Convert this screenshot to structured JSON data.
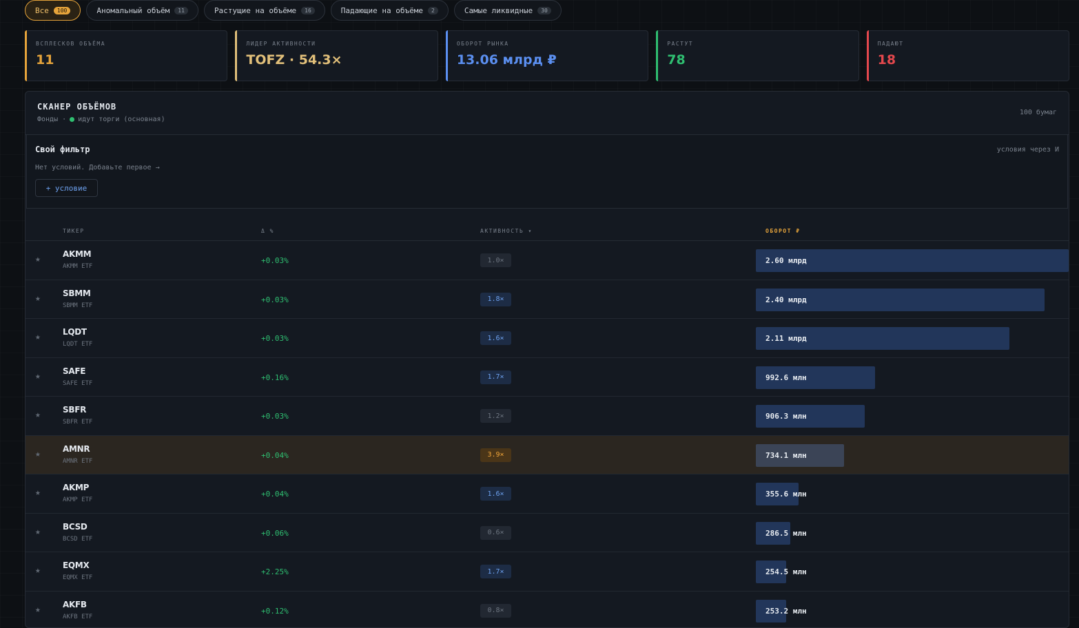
{
  "tabs": [
    {
      "label": "Все",
      "count": "100"
    },
    {
      "label": "Аномальный объём",
      "count": "11"
    },
    {
      "label": "Растущие на объёме",
      "count": "16"
    },
    {
      "label": "Падающие на объёме",
      "count": "2"
    },
    {
      "label": "Самые ликвидные",
      "count": "30"
    }
  ],
  "stats": [
    {
      "label": "всплесков объёма",
      "value": "11",
      "color": "#e6a43b"
    },
    {
      "label": "лидер активности",
      "value": "TOFZ · 54.3×",
      "color": "#e2c07a"
    },
    {
      "label": "оборот рынка",
      "value": "13.06 млрд ₽",
      "color": "#5b8ff0"
    },
    {
      "label": "растут",
      "value": "78",
      "color": "#2fbf71"
    },
    {
      "label": "падают",
      "value": "18",
      "color": "#e5484d"
    }
  ],
  "panel": {
    "title": "СКАНЕР ОБЪЁМОВ",
    "sub_prefix": "Фонды ·",
    "sub_status": "идут торги (основная)",
    "count": "100 бумаг"
  },
  "filter": {
    "title": "Свой фильтр",
    "hint": "условия через И",
    "empty": "Нет условий. Добавьте первое →",
    "add_label": "+ условие"
  },
  "columns": {
    "ticker": "ТИКЕР",
    "change": "Δ %",
    "activity": "АКТИВНОСТЬ ▾",
    "turnover": "ОБОРОТ ₽"
  },
  "rows": [
    {
      "ticker": "AKMM",
      "name": "AKMM ETF",
      "change": "+0.03%",
      "activity": "1.0×",
      "level": "gray",
      "turnover": "2.60 млрд",
      "frac": 1.0
    },
    {
      "ticker": "SBMM",
      "name": "SBMM ETF",
      "change": "+0.03%",
      "activity": "1.8×",
      "level": "blue",
      "turnover": "2.40 млрд",
      "frac": 0.923
    },
    {
      "ticker": "LQDT",
      "name": "LQDT ETF",
      "change": "+0.03%",
      "activity": "1.6×",
      "level": "blue",
      "turnover": "2.11 млрд",
      "frac": 0.81
    },
    {
      "ticker": "SAFE",
      "name": "SAFE ETF",
      "change": "+0.16%",
      "activity": "1.7×",
      "level": "blue",
      "turnover": "992.6 млн",
      "frac": 0.382
    },
    {
      "ticker": "SBFR",
      "name": "SBFR ETF",
      "change": "+0.03%",
      "activity": "1.2×",
      "level": "gray",
      "turnover": "906.3 млн",
      "frac": 0.349
    },
    {
      "ticker": "AMNR",
      "name": "AMNR ETF",
      "change": "+0.04%",
      "activity": "3.9×",
      "level": "orange",
      "turnover": "734.1 млн",
      "frac": 0.282,
      "highlight": true
    },
    {
      "ticker": "AKMP",
      "name": "AKMP ETF",
      "change": "+0.04%",
      "activity": "1.6×",
      "level": "blue",
      "turnover": "355.6 млн",
      "frac": 0.137
    },
    {
      "ticker": "BCSD",
      "name": "BCSD ETF",
      "change": "+0.06%",
      "activity": "0.6×",
      "level": "gray",
      "turnover": "286.5 млн",
      "frac": 0.11
    },
    {
      "ticker": "EQMX",
      "name": "EQMX ETF",
      "change": "+2.25%",
      "activity": "1.7×",
      "level": "blue",
      "turnover": "254.5 млн",
      "frac": 0.098
    },
    {
      "ticker": "AKFB",
      "name": "AKFB ETF",
      "change": "+0.12%",
      "activity": "0.8×",
      "level": "gray",
      "turnover": "253.2 млн",
      "frac": 0.097
    }
  ]
}
